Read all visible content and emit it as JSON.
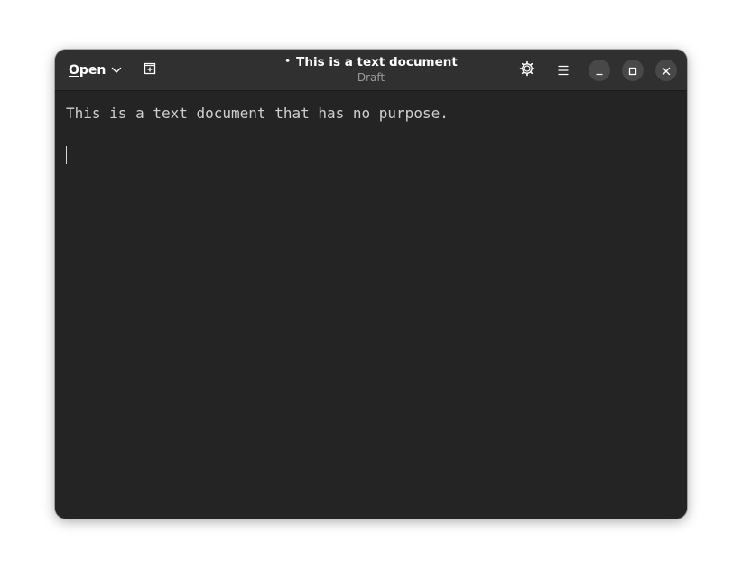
{
  "header": {
    "open_label_first": "O",
    "open_label_rest": "pen",
    "title": "This is a text document",
    "modified_marker": "•",
    "subtitle": "Draft"
  },
  "icons": {
    "open_dropdown": "chevron-down-icon",
    "new_tab": "new-tab-icon",
    "settings": "gear-icon",
    "menu": "hamburger-menu-icon",
    "minimize": "minimize-icon",
    "maximize": "maximize-icon",
    "close": "close-icon"
  },
  "editor": {
    "line1": "This is a text document that has no purpose.",
    "line2": ""
  },
  "colors": {
    "window_bg": "#242424",
    "headerbar_bg": "#303030",
    "window_button_bg": "#484848",
    "text": "#cfcfcf"
  }
}
